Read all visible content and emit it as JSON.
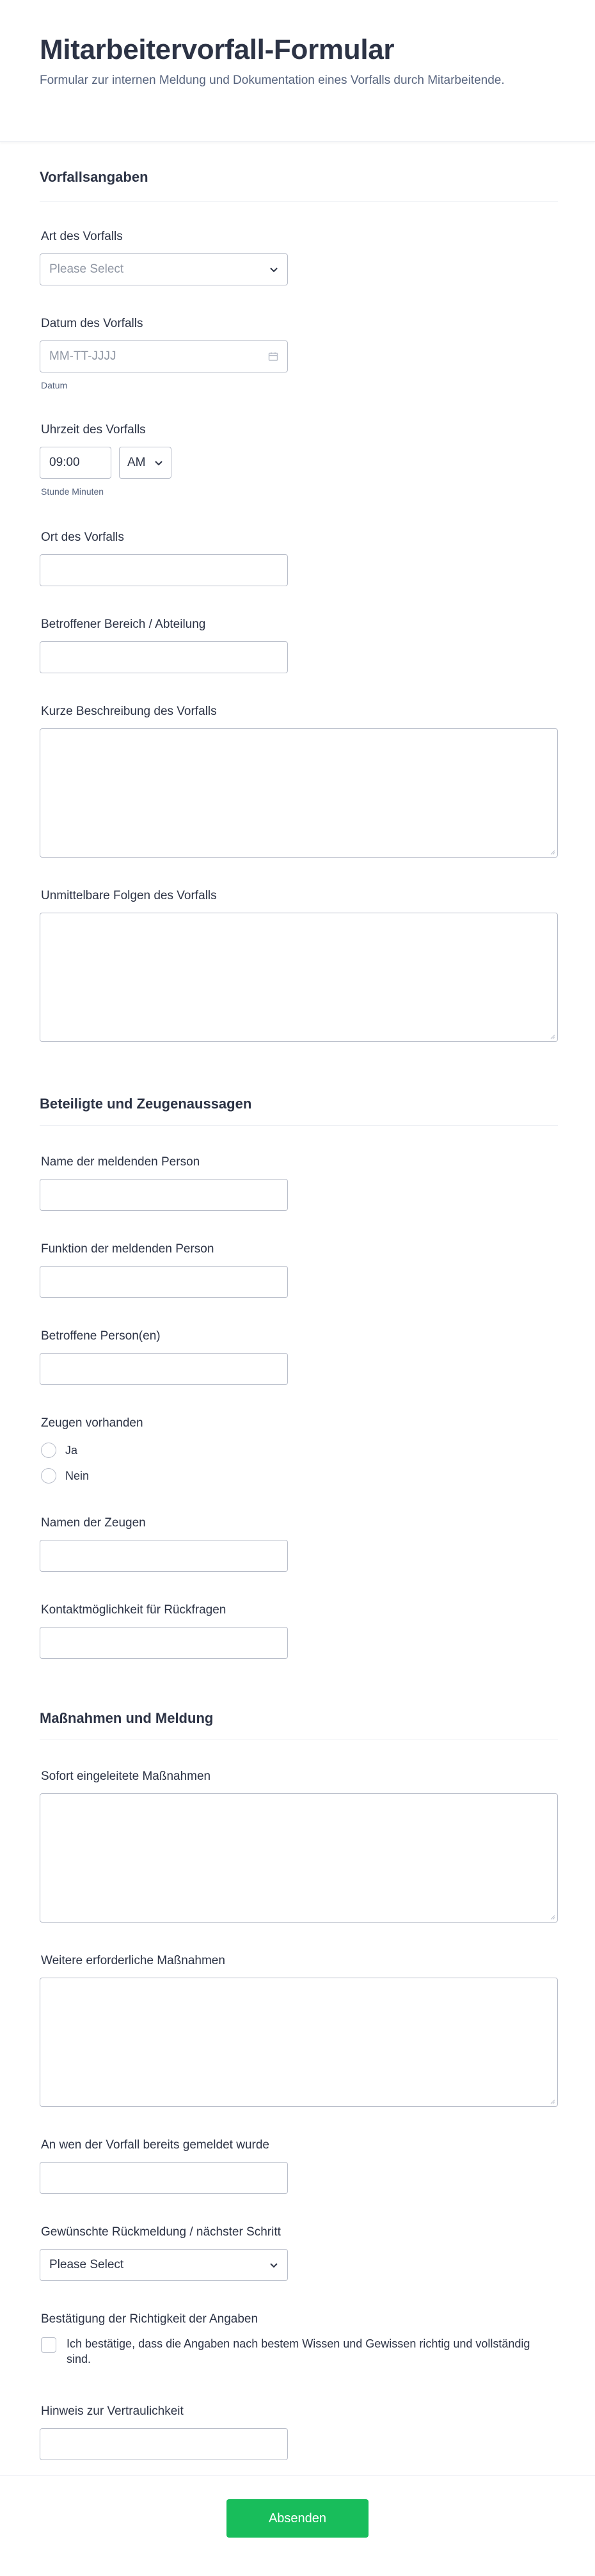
{
  "header": {
    "title": "Mitarbeitervorfall-Formular",
    "subtitle": "Formular zur internen Meldung und Dokumentation eines Vorfalls durch Mitarbeitende."
  },
  "sections": {
    "incident": "Vorfallsangaben",
    "involved": "Beteiligte und Zeugenaussagen",
    "measures": "Maßnahmen und Meldung"
  },
  "fields": {
    "type": {
      "label": "Art des Vorfalls",
      "value": "Please Select"
    },
    "date": {
      "label": "Datum des Vorfalls",
      "placeholder": "MM-TT-JJJJ",
      "sublabel": "Datum"
    },
    "time": {
      "label": "Uhrzeit des Vorfalls",
      "value": "09:00",
      "ampm": "AM",
      "sublabel": "Stunde Minuten"
    },
    "location": {
      "label": "Ort des Vorfalls"
    },
    "department": {
      "label": "Betroffener Bereich / Abteilung"
    },
    "description": {
      "label": "Kurze Beschreibung des Vorfalls"
    },
    "consequences": {
      "label": "Unmittelbare Folgen des Vorfalls"
    },
    "reporter_name": {
      "label": "Name der meldenden Person"
    },
    "reporter_role": {
      "label": "Funktion der meldenden Person"
    },
    "affected": {
      "label": "Betroffene Person(en)"
    },
    "witnesses": {
      "label": "Zeugen vorhanden",
      "options": [
        "Ja",
        "Nein"
      ]
    },
    "witness_names": {
      "label": "Namen der Zeugen"
    },
    "contact": {
      "label": "Kontaktmöglichkeit für Rückfragen"
    },
    "immediate_measures": {
      "label": "Sofort eingeleitete Maßnahmen"
    },
    "further_measures": {
      "label": "Weitere erforderliche Maßnahmen"
    },
    "reported_to": {
      "label": "An wen der Vorfall bereits gemeldet wurde"
    },
    "feedback": {
      "label": "Gewünschte Rückmeldung / nächster Schritt",
      "value": "Please Select"
    },
    "confirmation": {
      "label": "Bestätigung der Richtigkeit der Angaben",
      "text": "Ich bestätige, dass die Angaben nach bestem Wissen und Gewissen richtig und vollständig sind."
    },
    "confidentiality": {
      "label": "Hinweis zur Vertraulichkeit"
    }
  },
  "footer": {
    "submit_label": "Absenden"
  },
  "colors": {
    "accent": "#18bd5b",
    "text": "#2c3345",
    "border": "#b8bdc9"
  }
}
